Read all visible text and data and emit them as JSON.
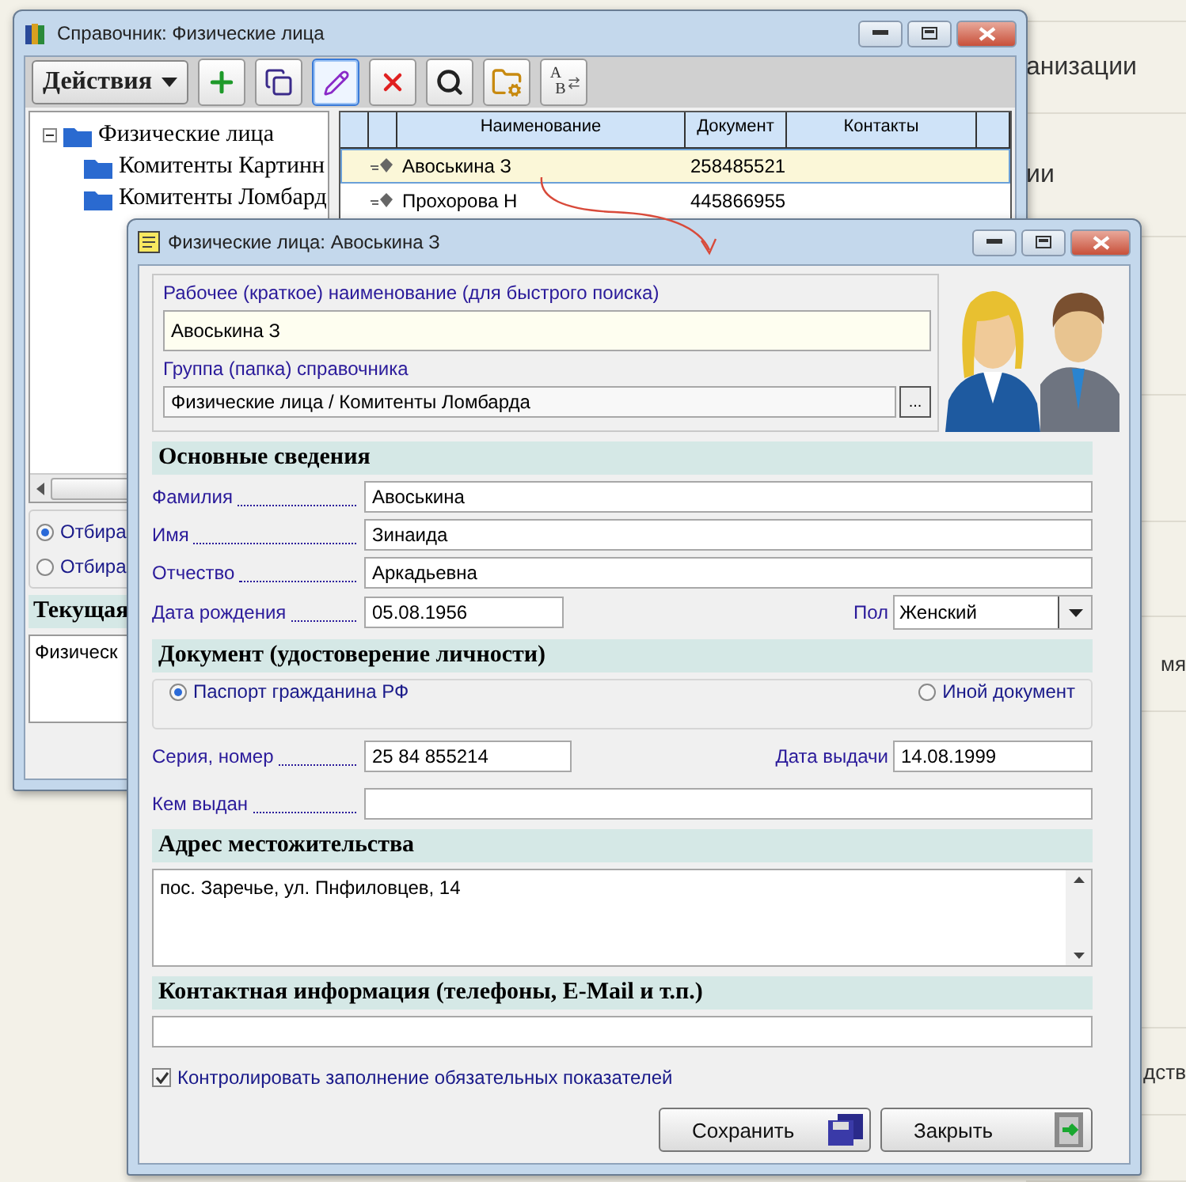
{
  "background_page": {
    "items": [
      "анизации",
      "ии",
      "мя",
      "дств"
    ]
  },
  "list_window": {
    "title": "Справочник: Физические лица",
    "actions_button": "Действия",
    "toolbar": [
      {
        "kind": "add",
        "selected": false
      },
      {
        "kind": "copy",
        "selected": false
      },
      {
        "kind": "edit",
        "selected": true
      },
      {
        "kind": "delete",
        "selected": false
      },
      {
        "kind": "search",
        "selected": false
      },
      {
        "kind": "folder",
        "selected": false
      },
      {
        "kind": "letters",
        "letters": [
          "A",
          "B"
        ],
        "selected": false
      }
    ],
    "tree": {
      "label": "Физические лица",
      "expanded": true,
      "children": [
        {
          "label": "Комитенты Картинн"
        },
        {
          "label": "Комитенты Ломбард"
        }
      ]
    },
    "grid": {
      "columns": [
        "Наименование",
        "Документ",
        "Контакты"
      ],
      "rows": [
        {
          "name": "Авоськина З",
          "document": "258485521",
          "selected": true
        },
        {
          "name": "Прохорова Н",
          "document": "445866955",
          "selected": false
        }
      ]
    },
    "filter_options": [
      {
        "label": "Отбира",
        "selected": true
      },
      {
        "label": "Отбира",
        "selected": false
      }
    ],
    "current_group": {
      "heading": "Текущая",
      "value": "Физическ"
    }
  },
  "form_window": {
    "title": "Физические лица: Авоськина З",
    "short_name": {
      "label": "Рабочее (краткое) наименование (для быстрого поиска)",
      "value": "Авоськина З"
    },
    "group": {
      "label": "Группа (папка) справочника",
      "value": "Физические лица / Комитенты Ломбарда",
      "button": "..."
    },
    "main_heading": "Основные сведения",
    "surname": {
      "label": "Фамилия",
      "value": "Авоськина"
    },
    "first_name": {
      "label": "Имя",
      "value": "Зинаида"
    },
    "patronymic": {
      "label": "Отчество",
      "value": "Аркадьевна"
    },
    "birth_date": {
      "label": "Дата рождения",
      "value": "05.08.1956"
    },
    "sex": {
      "label": "Пол",
      "value": "Женский"
    },
    "document_heading": "Документ (удостоверение личности)",
    "document_types": [
      {
        "label": "Паспорт гражданина РФ",
        "selected": true
      },
      {
        "label": "Иной документ",
        "selected": false
      }
    ],
    "series_number": {
      "label": "Серия, номер",
      "value": "25 84 855214"
    },
    "issue_date": {
      "label": "Дата выдачи",
      "value": "14.08.1999"
    },
    "issued_by": {
      "label": "Кем выдан"
    },
    "address_heading": "Адрес местожительства",
    "address": "пос. Заречье, ул. Пнфиловцев, 14",
    "contacts_heading": "Контактная информация (телефоны, E-Mail и т.п.)",
    "validate": {
      "label": "Контролировать заполнение обязательных показателей",
      "checked": true
    },
    "buttons": [
      {
        "label": "Сохранить",
        "kind": "save"
      },
      {
        "label": "Закрыть",
        "kind": "close"
      }
    ]
  }
}
